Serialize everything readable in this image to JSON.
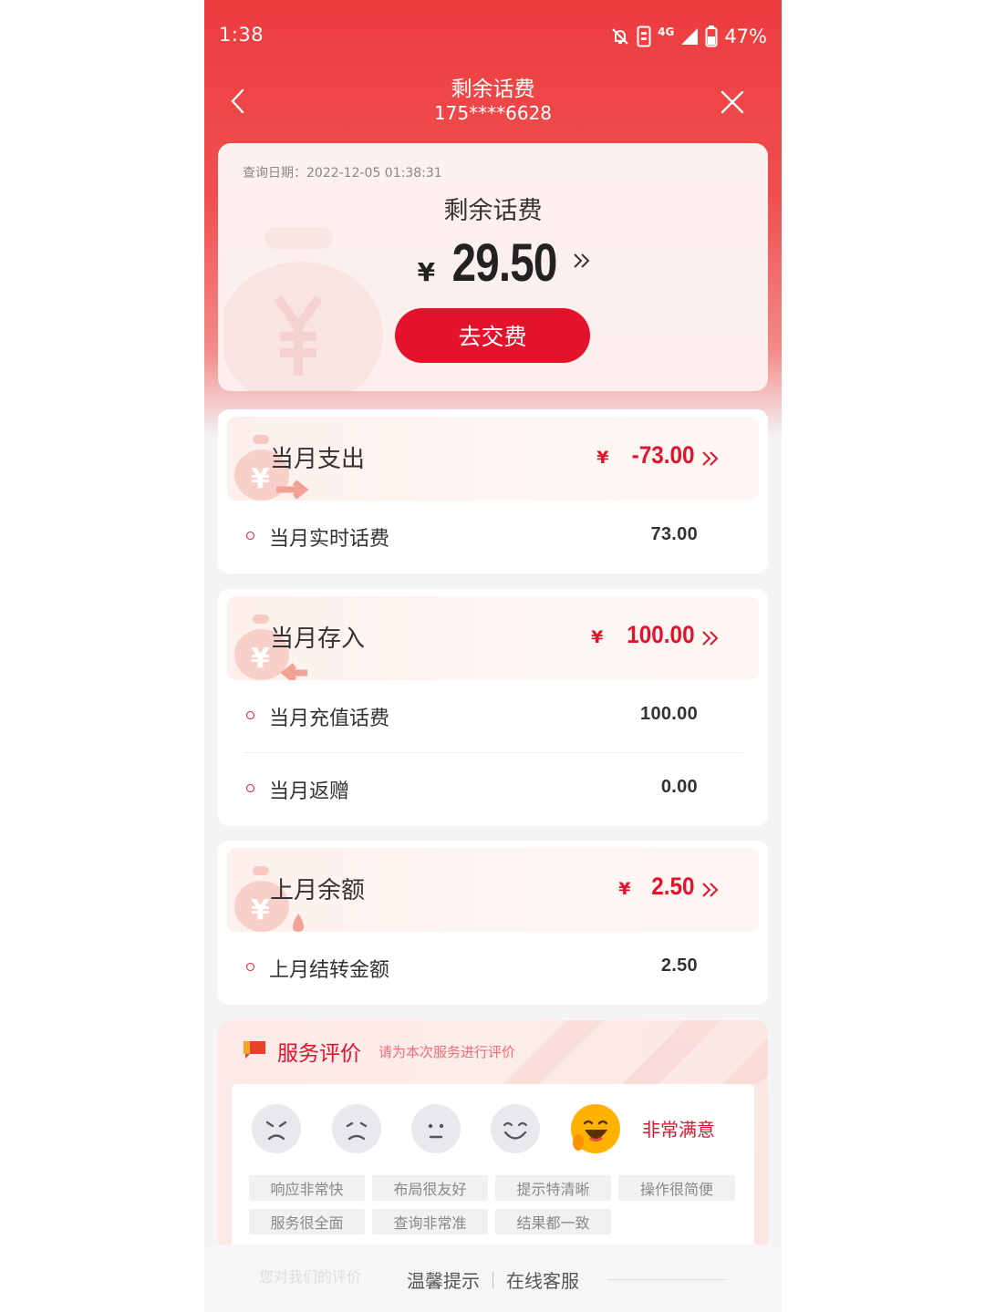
{
  "status_bar": {
    "time": "1:38",
    "network": "4G",
    "battery": "47%"
  },
  "nav": {
    "title": "剩余话费",
    "phone": "175****6628",
    "back_icon": "chevron-left-icon",
    "close_icon": "close-icon"
  },
  "balance": {
    "query_date": "查询日期：2022-12-05 01:38:31",
    "label": "剩余话费",
    "currency": "¥",
    "amount": "29.50",
    "pay_button": "去交费"
  },
  "sections": [
    {
      "title": "当月支出",
      "currency": "¥",
      "amount": "-73.00",
      "rows": [
        {
          "label": "当月实时话费",
          "value": "73.00"
        }
      ]
    },
    {
      "title": "当月存入",
      "currency": "¥",
      "amount": "100.00",
      "rows": [
        {
          "label": "当月充值话费",
          "value": "100.00"
        },
        {
          "label": "当月返赠",
          "value": "0.00"
        }
      ]
    },
    {
      "title": "上月余额",
      "currency": "¥",
      "amount": "2.50",
      "rows": [
        {
          "label": "上月结转金额",
          "value": "2.50"
        }
      ]
    }
  ],
  "rating": {
    "title": "服务评价",
    "hint": "请为本次服务进行评价",
    "selected_label": "非常满意",
    "tags": [
      "响应非常快",
      "布局很友好",
      "提示特清晰",
      "操作很简便",
      "服务很全面",
      "查询非常准",
      "结果都一致"
    ],
    "colors": {
      "accent": "#e3132b",
      "selected_face": "#ffb300"
    }
  },
  "bottom": {
    "faded_text": "您对我们的评价",
    "tips": "温馨提示",
    "service": "在线客服"
  },
  "colors": {
    "brand_red": "#e3132b",
    "header_red": "#ec3c3e"
  }
}
